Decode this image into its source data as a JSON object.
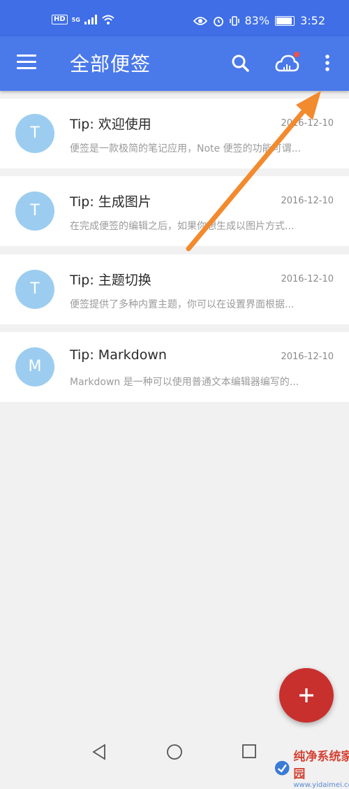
{
  "status_bar": {
    "hd": "HD",
    "net": "5G",
    "battery": "83%",
    "battery_level": 0.83,
    "time": "3:52"
  },
  "toolbar": {
    "title": "全部便签",
    "menu_icon": "hamburger-menu-icon",
    "search_icon": "search-icon",
    "cloud_icon": "cloud-sync-icon",
    "more_icon": "more-vertical-icon"
  },
  "notes": [
    {
      "avatar": "T",
      "title": "Tip: 欢迎使用",
      "date": "2016-12-10",
      "preview": "便签是一款极简的笔记应用，Note 便签的功能可谓..."
    },
    {
      "avatar": "T",
      "title": "Tip: 生成图片",
      "date": "2016-12-10",
      "preview": "在完成便签的编辑之后，如果你想生成以图片方式..."
    },
    {
      "avatar": "T",
      "title": "Tip: 主题切换",
      "date": "2016-12-10",
      "preview": "便签提供了多种内置主题，你可以在设置界面根据..."
    },
    {
      "avatar": "M",
      "title": "Tip: Markdown",
      "date": "2016-12-10",
      "preview": "Markdown 是一种可以使用普通文本编辑器编写的..."
    }
  ],
  "fab": {
    "icon": "plus-icon"
  },
  "colors": {
    "toolbar": "#4a79ea",
    "status_bar": "#3f6ee7",
    "avatar": "#9ccdf0",
    "fab": "#c8302e",
    "annotation_arrow": "#f28a2e"
  },
  "watermark": {
    "title": "纯净系统家园",
    "url": "www.yidaimei.com"
  }
}
